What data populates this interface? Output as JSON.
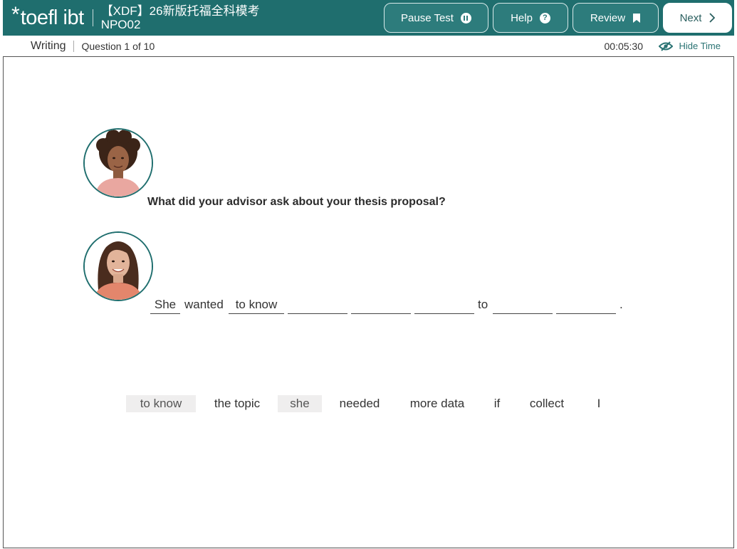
{
  "header": {
    "logo_star": "*",
    "logo_text": "toefl ibt",
    "title_line1": "【XDF】26新版托福全科模考",
    "title_line2": "NPO02",
    "buttons": {
      "pause": "Pause Test",
      "help": "Help",
      "review": "Review",
      "next": "Next"
    }
  },
  "subbar": {
    "section": "Writing",
    "question_count": "Question 1 of 10",
    "timer": "00:05:30",
    "hide_time": "Hide Time"
  },
  "main": {
    "question": "What did your advisor ask about your thesis proposal?",
    "sentence": {
      "w1": "She",
      "w2": "wanted",
      "w3": "to know",
      "w4": "to",
      "end": "."
    },
    "word_bank": [
      "to know",
      "the topic",
      "she",
      "needed",
      "more data",
      "if",
      "collect",
      "I"
    ],
    "word_bank_used": [
      true,
      false,
      true,
      false,
      false,
      false,
      false,
      false
    ]
  },
  "colors": {
    "header_bg": "#1f6e6e",
    "accent": "#2d7c7c",
    "used_chip_bg": "#efeeee"
  }
}
